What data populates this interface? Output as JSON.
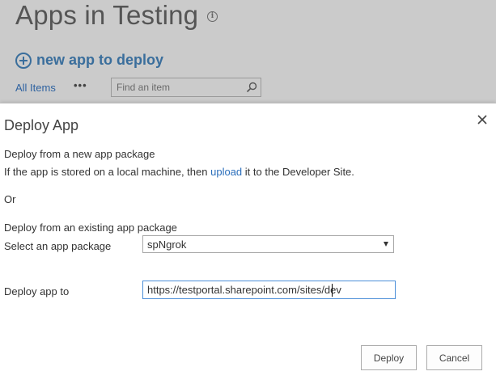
{
  "page": {
    "title": "Apps in Testing",
    "new_app_label": "new app to deploy",
    "all_items_label": "All Items",
    "more_label": "•••",
    "find_placeholder": "Find an item"
  },
  "dialog": {
    "title": "Deploy App",
    "new_package_heading": "Deploy from a new app package",
    "local_prefix": "If the app is stored on a local machine, then ",
    "upload_link": "upload",
    "local_suffix": " it to the Developer Site.",
    "or_label": "Or",
    "existing_package_heading": "Deploy from an existing app package",
    "select_label": "Select an app package",
    "select_value": "spNgrok",
    "deploy_to_label": "Deploy app to",
    "deploy_to_value": "https://testportal.sharepoint.com/sites/dev",
    "deploy_button": "Deploy",
    "cancel_button": "Cancel"
  },
  "colors": {
    "accent": "#3a6e9c",
    "link": "#2a6ebb",
    "backdrop": "#cbcbcb",
    "input_focus_border": "#4c8fd8"
  },
  "icons": [
    "info-icon",
    "plus-circle-icon",
    "more-icon",
    "search-icon",
    "close-icon",
    "dropdown-arrow-icon"
  ]
}
